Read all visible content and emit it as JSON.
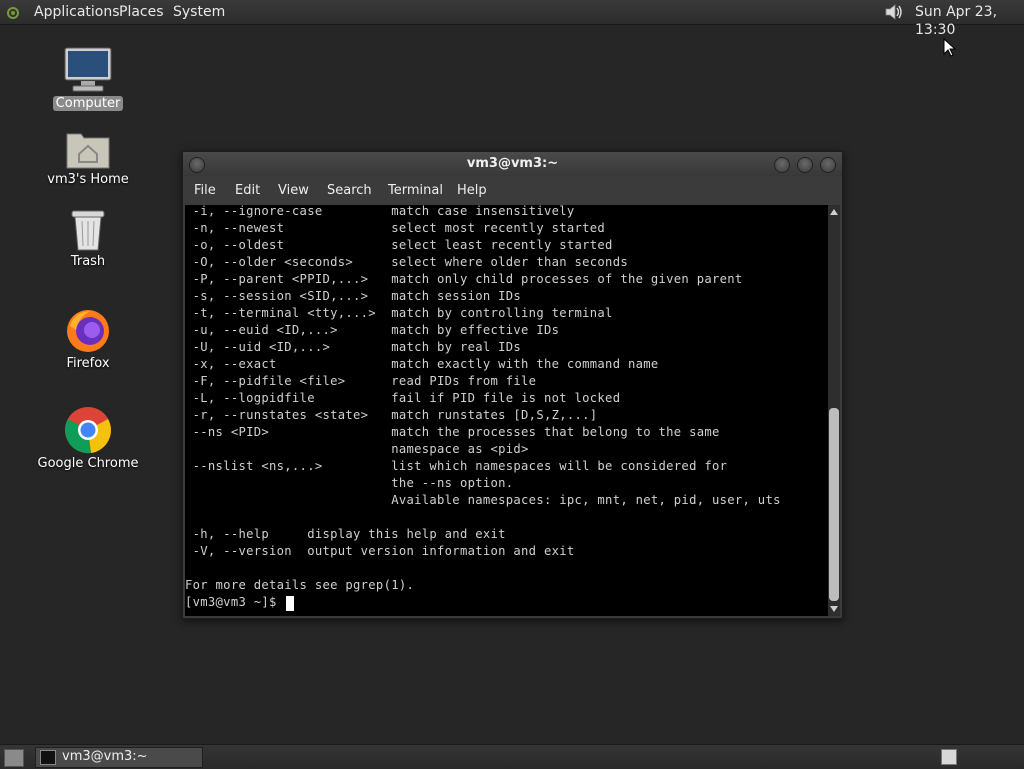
{
  "top_panel": {
    "menus": [
      "Applications",
      "Places",
      "System"
    ],
    "clock": "Sun Apr 23, 13:30",
    "volume_icon": "speaker-icon"
  },
  "desktop_icons": [
    {
      "label": "Computer",
      "icon": "computer-icon",
      "selected": true
    },
    {
      "label": "vm3's Home",
      "icon": "home-folder-icon",
      "selected": false
    },
    {
      "label": "Trash",
      "icon": "trash-icon",
      "selected": false
    },
    {
      "label": "Firefox",
      "icon": "firefox-icon",
      "selected": false
    },
    {
      "label": "Google Chrome",
      "icon": "chrome-icon",
      "selected": false
    }
  ],
  "terminal": {
    "title": "vm3@vm3:~",
    "menu": [
      "File",
      "Edit",
      "View",
      "Search",
      "Terminal",
      "Help"
    ],
    "lines": [
      " -i, --ignore-case         match case insensitively",
      " -n, --newest              select most recently started",
      " -o, --oldest              select least recently started",
      " -O, --older <seconds>     select where older than seconds",
      " -P, --parent <PPID,...>   match only child processes of the given parent",
      " -s, --session <SID,...>   match session IDs",
      " -t, --terminal <tty,...>  match by controlling terminal",
      " -u, --euid <ID,...>       match by effective IDs",
      " -U, --uid <ID,...>        match by real IDs",
      " -x, --exact               match exactly with the command name",
      " -F, --pidfile <file>      read PIDs from file",
      " -L, --logpidfile          fail if PID file is not locked",
      " -r, --runstates <state>   match runstates [D,S,Z,...]",
      " --ns <PID>                match the processes that belong to the same",
      "                           namespace as <pid>",
      " --nslist <ns,...>         list which namespaces will be considered for",
      "                           the --ns option.",
      "                           Available namespaces: ipc, mnt, net, pid, user, uts",
      "",
      " -h, --help     display this help and exit",
      " -V, --version  output version information and exit",
      "",
      "For more details see pgrep(1).",
      "[vm3@vm3 ~]$ "
    ]
  },
  "taskbar": {
    "task_label": "vm3@vm3:~"
  }
}
